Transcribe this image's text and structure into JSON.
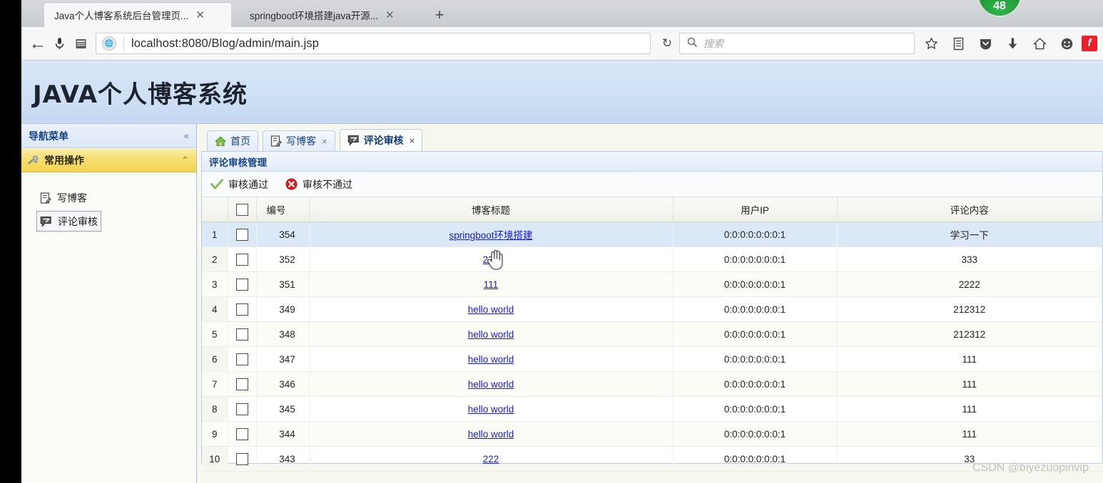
{
  "browser": {
    "tabs": [
      {
        "title": "Java个人博客系统后台管理页...",
        "close": "✕",
        "active": true
      },
      {
        "title": "springboot环境搭建java开源...",
        "close": "✕",
        "active": false
      }
    ],
    "new_tab_label": "+",
    "badge_count": "48",
    "nav": {
      "back_icon": "←",
      "mic_icon": "microphone-icon",
      "reader_icon": "reader-icon",
      "site_identity_icon": "globe-icon",
      "url": "localhost:8080/Blog/admin/main.jsp",
      "url_host": "localhost",
      "url_path": ":8080/Blog/admin/main.jsp",
      "reload_icon": "↻",
      "search_placeholder": "搜索",
      "tools": [
        "bookmark-star-icon",
        "library-icon",
        "pocket-icon",
        "downloads-icon",
        "home-icon",
        "smiley-icon",
        "flash-icon"
      ],
      "flash_label": "f"
    }
  },
  "site": {
    "title": "JAVA个人博客系统"
  },
  "sidebar": {
    "header": "导航菜单",
    "collapse_icon": "«",
    "accordion": {
      "label": "常用操作",
      "chevron": "⌃"
    },
    "items": [
      {
        "label": "写博客",
        "icon": "write-blog-icon",
        "focused": false
      },
      {
        "label": "评论审核",
        "icon": "comment-review-icon",
        "focused": true
      }
    ]
  },
  "tabs": [
    {
      "label": "首页",
      "icon": "home-icon",
      "closable": false,
      "active": false
    },
    {
      "label": "写博客",
      "icon": "write-blog-icon",
      "closable": true,
      "close": "×",
      "active": false
    },
    {
      "label": "评论审核",
      "icon": "comment-review-icon",
      "closable": true,
      "close": "×",
      "active": true
    }
  ],
  "panel": {
    "title": "评论审核管理",
    "toolbar": [
      {
        "label": "审核通过",
        "icon": "green-check-icon"
      },
      {
        "label": "审核不通过",
        "icon": "red-x-icon"
      }
    ]
  },
  "table": {
    "headers": [
      "",
      "",
      "编号",
      "博客标题",
      "用户IP",
      "评论内容"
    ],
    "rows": [
      {
        "idx": "1",
        "no": "354",
        "title": "springboot环境搭建",
        "ip": "0:0:0:0:0:0:0:1",
        "comment": "学习一下"
      },
      {
        "idx": "2",
        "no": "352",
        "title": "222",
        "ip": "0:0:0:0:0:0:0:1",
        "comment": "333"
      },
      {
        "idx": "3",
        "no": "351",
        "title": "111",
        "ip": "0:0:0:0:0:0:0:1",
        "comment": "2222"
      },
      {
        "idx": "4",
        "no": "349",
        "title": "hello world",
        "ip": "0:0:0:0:0:0:0:1",
        "comment": "212312"
      },
      {
        "idx": "5",
        "no": "348",
        "title": "hello world",
        "ip": "0:0:0:0:0:0:0:1",
        "comment": "212312"
      },
      {
        "idx": "6",
        "no": "347",
        "title": "hello world",
        "ip": "0:0:0:0:0:0:0:1",
        "comment": "111"
      },
      {
        "idx": "7",
        "no": "346",
        "title": "hello world",
        "ip": "0:0:0:0:0:0:0:1",
        "comment": "111"
      },
      {
        "idx": "8",
        "no": "345",
        "title": "hello world",
        "ip": "0:0:0:0:0:0:0:1",
        "comment": "111"
      },
      {
        "idx": "9",
        "no": "344",
        "title": "hello world",
        "ip": "0:0:0:0:0:0:0:1",
        "comment": "111"
      },
      {
        "idx": "10",
        "no": "343",
        "title": "222",
        "ip": "0:0:0:0:0:0:0:1",
        "comment": "33"
      }
    ]
  },
  "watermark": "CSDN @biyezuopinvip"
}
